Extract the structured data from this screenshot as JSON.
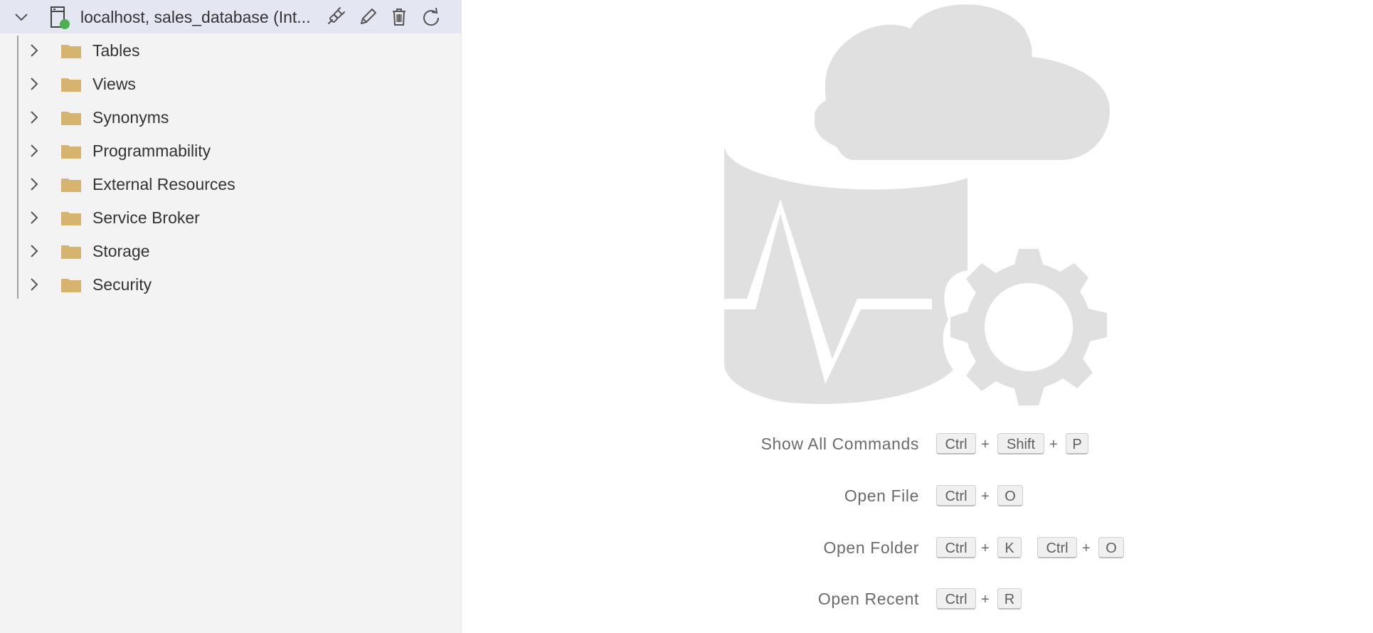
{
  "server": {
    "label": "localhost, sales_database (Int...",
    "status_color": "#4caf50",
    "actions": [
      "disconnect-icon",
      "edit-icon",
      "delete-icon",
      "refresh-icon"
    ]
  },
  "tree": {
    "folder_color": "#d6b36f",
    "items": [
      {
        "label": "Tables"
      },
      {
        "label": "Views"
      },
      {
        "label": "Synonyms"
      },
      {
        "label": "Programmability"
      },
      {
        "label": "External Resources"
      },
      {
        "label": "Service Broker"
      },
      {
        "label": "Storage"
      },
      {
        "label": "Security"
      }
    ]
  },
  "watermark": {
    "color": "#e0e0e0"
  },
  "shortcuts": [
    {
      "label": "Show All Commands",
      "keys": [
        "Ctrl",
        "+",
        "Shift",
        "+",
        "P"
      ]
    },
    {
      "label": "Open File",
      "keys": [
        "Ctrl",
        "+",
        "O"
      ]
    },
    {
      "label": "Open Folder",
      "keys": [
        "Ctrl",
        "+",
        "K",
        "Ctrl",
        "+",
        "O"
      ]
    },
    {
      "label": "Open Recent",
      "keys": [
        "Ctrl",
        "+",
        "R"
      ]
    }
  ]
}
